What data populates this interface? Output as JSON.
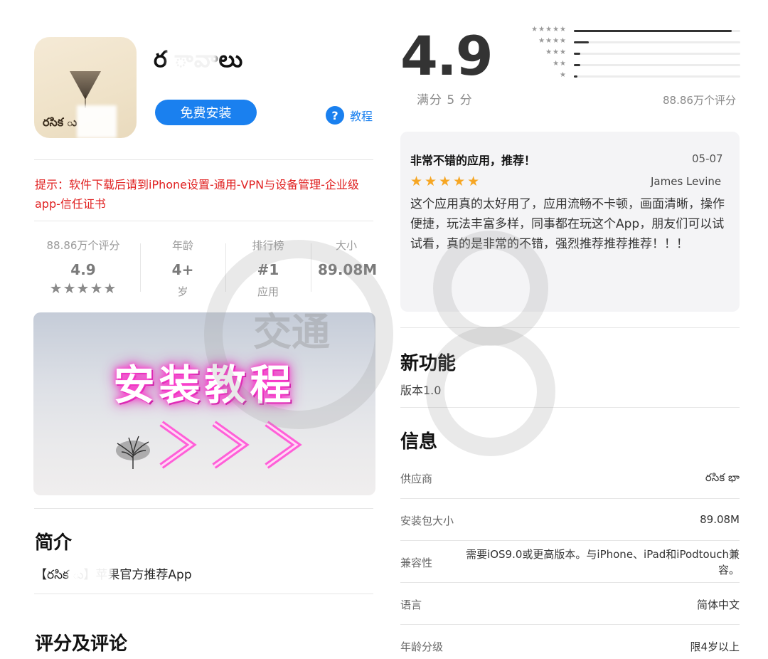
{
  "app": {
    "name": "ర  ావాలు",
    "icon_text": "రసిక  ు",
    "install_label": "免费安装",
    "help_icon": "?",
    "help_label": "教程"
  },
  "tip": "提示：软件下载后请到iPhone设置-通用-VPN与设备管理-企业级app-信任证书",
  "stats": {
    "ratings": {
      "label": "88.86万个评分",
      "value": "4.9",
      "stars": "★★★★★",
      "stars_value": 5
    },
    "age": {
      "label": "年龄",
      "value": "4+",
      "sub": "岁"
    },
    "rank": {
      "label": "排行榜",
      "value": "#1",
      "sub": "应用"
    },
    "size": {
      "label": "大小",
      "value": "89.08M"
    }
  },
  "banner": {
    "title": "安装教程"
  },
  "intro": {
    "heading": "简介",
    "text": "【రసిక  ు】苹果官方推荐App"
  },
  "reviews_heading": "评分及评论",
  "summary": {
    "rating": "4.9",
    "out_of": "满分 5 分",
    "count": "88.86万个评分",
    "bars": [
      {
        "stars": "★★★★★",
        "fraction": 0.95
      },
      {
        "stars": "★★★★",
        "fraction": 0.09
      },
      {
        "stars": "★★★",
        "fraction": 0.04
      },
      {
        "stars": "★★",
        "fraction": 0.04
      },
      {
        "stars": "★",
        "fraction": 0.02
      }
    ]
  },
  "review": {
    "title": "非常不错的应用，推荐！",
    "date": "05-07",
    "stars": "★★★★★",
    "stars_value": 5,
    "author": "James Levine",
    "body": "这个应用真的太好用了，应用流畅不卡顿，画面清晰，操作便捷，玩法丰富多样，同事都在玩这个App，朋友们可以试试看，真的是非常的不错，强烈推荐推荐推荐！！！"
  },
  "new_features": {
    "heading": "新功能",
    "version": "版本1.0"
  },
  "info": {
    "heading": "信息",
    "rows": [
      {
        "label": "供应商",
        "value": "రసిక భా"
      },
      {
        "label": "安装包大小",
        "value": "89.08M"
      },
      {
        "label": "兼容性",
        "value": "需要iOS9.0或更高版本。与iPhone、iPad和iPodtouch兼容。"
      },
      {
        "label": "语言",
        "value": "简体中文"
      },
      {
        "label": "年龄分级",
        "value": "限4岁以上"
      }
    ]
  },
  "watermark": {
    "text": "交通"
  },
  "colors": {
    "accent": "#1a80ef",
    "tip_red": "#e02020",
    "star_orange": "#f6a623",
    "banner_glow": "#ff3fcf"
  }
}
